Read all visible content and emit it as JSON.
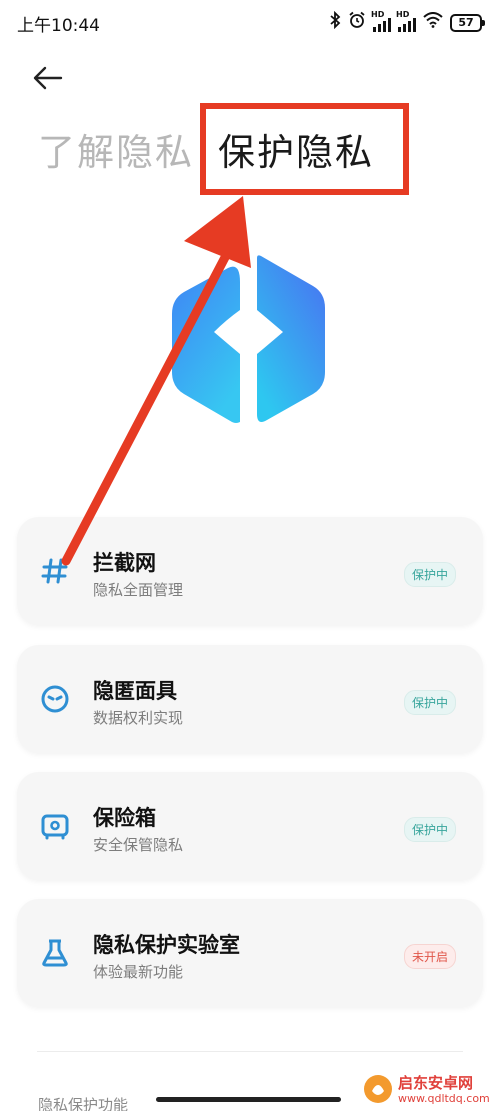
{
  "status_bar": {
    "time": "上午10:44",
    "hd_label": "HD",
    "battery": "57",
    "icons": [
      "bluetooth-icon",
      "alarm-icon",
      "signal-icon",
      "signal-icon",
      "wifi-icon",
      "battery-icon"
    ]
  },
  "header": {
    "tabs": [
      {
        "label": "了解隐私",
        "active": false
      },
      {
        "label": "保护隐私",
        "active": true
      }
    ]
  },
  "features": [
    {
      "title": "拦截网",
      "subtitle": "隐私全面管理",
      "status": "保护中",
      "icon": "hash-icon"
    },
    {
      "title": "隐匿面具",
      "subtitle": "数据权利实现",
      "status": "保护中",
      "icon": "mask-icon"
    },
    {
      "title": "保险箱",
      "subtitle": "安全保管隐私",
      "status": "保护中",
      "icon": "safe-icon"
    },
    {
      "title": "隐私保护实验室",
      "subtitle": "体验最新功能",
      "status": "未开启",
      "icon": "flask-icon"
    }
  ],
  "section_label": "隐私保护功能",
  "watermark": {
    "name": "启东安卓网",
    "url": "www.qdltdq.com"
  },
  "colors": {
    "accent_blue": "#3a8ef6",
    "status_on": "#37a59c",
    "status_off": "#e0564a",
    "annotation_red": "#e63b23"
  }
}
